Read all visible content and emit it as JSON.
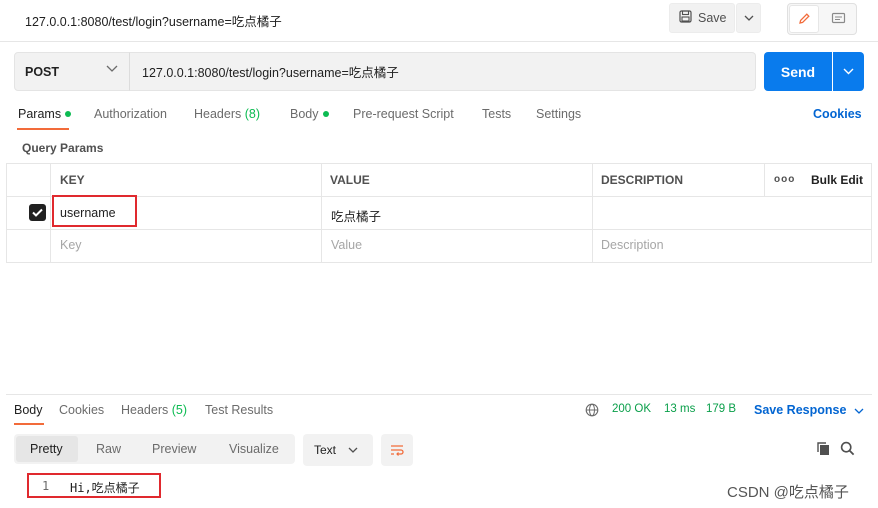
{
  "request": {
    "title": "127.0.0.1:8080/test/login?username=吃点橘子",
    "save_label": "Save",
    "method": "POST",
    "url": "127.0.0.1:8080/test/login?username=吃点橘子",
    "send_label": "Send"
  },
  "request_tabs": [
    {
      "label": "Params",
      "active": true,
      "dot": true
    },
    {
      "label": "Authorization"
    },
    {
      "label": "Headers",
      "count": "(8)"
    },
    {
      "label": "Body",
      "dot": true
    },
    {
      "label": "Pre-request Script"
    },
    {
      "label": "Tests"
    },
    {
      "label": "Settings"
    }
  ],
  "cookies_label": "Cookies",
  "query_params": {
    "title": "Query Params",
    "columns": {
      "key": "KEY",
      "value": "VALUE",
      "description": "DESCRIPTION",
      "more": "ooo",
      "bulk_edit": "Bulk Edit"
    },
    "rows": [
      {
        "checked": true,
        "key": "username",
        "value": "吃点橘子",
        "description": ""
      }
    ],
    "placeholders": {
      "key": "Key",
      "value": "Value",
      "description": "Description"
    }
  },
  "response_tabs": [
    {
      "label": "Body",
      "active": true
    },
    {
      "label": "Cookies"
    },
    {
      "label": "Headers",
      "count": "(5)"
    },
    {
      "label": "Test Results"
    }
  ],
  "response_meta": {
    "status": "200 OK",
    "time": "13 ms",
    "size": "179 B",
    "save_response": "Save Response"
  },
  "view_modes": [
    "Pretty",
    "Raw",
    "Preview",
    "Visualize"
  ],
  "active_view": "Pretty",
  "format": "Text",
  "response_body": {
    "line_number": "1",
    "content": "Hi,吃点橘子"
  },
  "watermark": "CSDN @吃点橘子",
  "colors": {
    "accent_orange": "#f26b3a",
    "send_blue": "#097bed",
    "link_blue": "#0265d2",
    "success_green": "#0cbb52",
    "highlight_red": "#e0292e"
  }
}
